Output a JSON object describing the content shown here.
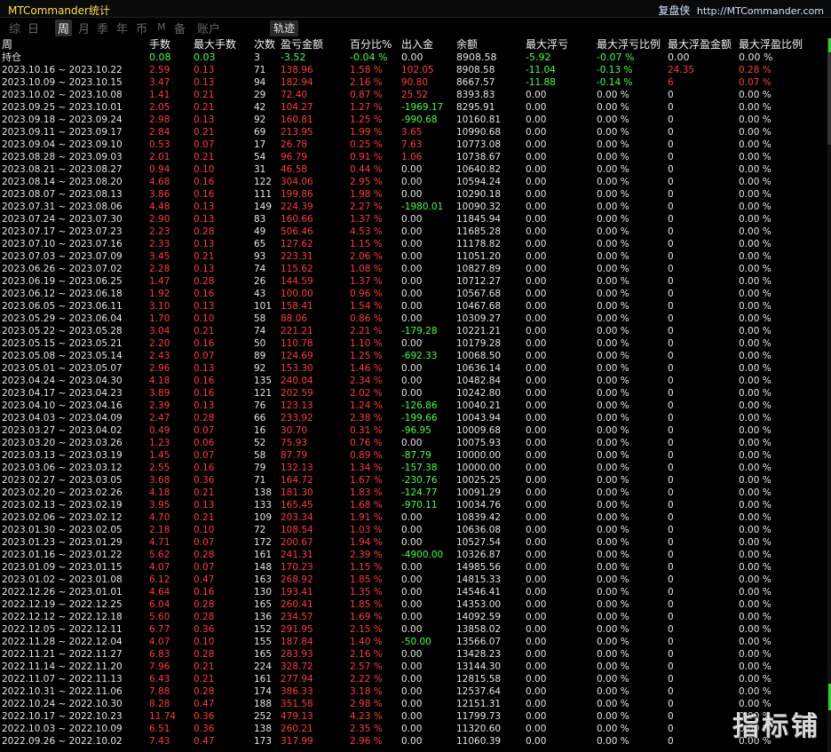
{
  "window": {
    "title": "MTCommander统计"
  },
  "brand": {
    "cn": "复盘侠",
    "url": "http://MTCommander.com"
  },
  "tabs": [
    {
      "label": "综",
      "active": false
    },
    {
      "label": "日",
      "active": false
    },
    {
      "label": "周",
      "active": true
    },
    {
      "label": "月",
      "active": false
    },
    {
      "label": "季",
      "active": false
    },
    {
      "label": "年",
      "active": false
    },
    {
      "label": "币",
      "active": false
    },
    {
      "label": "M",
      "active": false
    },
    {
      "label": "备",
      "active": false
    },
    {
      "label": "账户",
      "active": false
    }
  ],
  "track_button": "轨迹",
  "table": {
    "columns": [
      "周",
      "手数",
      "最大手数",
      "次数",
      "盈亏金额",
      "百分比%",
      "出入金",
      "余额",
      "最大浮亏",
      "最大浮亏比例",
      "最大浮盈金额",
      "最大浮盈比例"
    ],
    "holding": {
      "cells": [
        "持仓",
        "0.08",
        "0.03",
        "3",
        "-3.52",
        "-0.04 %",
        "0.00",
        "8908.58",
        "-5.92",
        "-0.07 %",
        "0.00",
        "0.00 %"
      ],
      "colors": [
        "w",
        "g",
        "g",
        "w",
        "g",
        "g",
        "w",
        "w",
        "g",
        "g",
        "w",
        "w"
      ]
    },
    "rows": [
      [
        "2023.10.16 ~ 2023.10.22",
        "2.59",
        "0.13",
        "71",
        "138.96",
        "1.58 %",
        "102.05",
        "8908.58",
        "-11.04",
        "-0.13 %",
        "24.35",
        "0.28 %"
      ],
      [
        "2023.10.09 ~ 2023.10.15",
        "3.47",
        "0.13",
        "94",
        "182.94",
        "2.16 %",
        "90.80",
        "8667.57",
        "-11.88",
        "-0.14 %",
        "6",
        "0.07 %"
      ],
      [
        "2023.10.02 ~ 2023.10.08",
        "1.41",
        "0.21",
        "29",
        "72.40",
        "0.87 %",
        "25.52",
        "8393.83",
        "0.00",
        "0.00 %",
        "0",
        "0.00 %"
      ],
      [
        "2023.09.25 ~ 2023.10.01",
        "2.05",
        "0.21",
        "42",
        "104.27",
        "1.27 %",
        "-1969.17",
        "8295.91",
        "0.00",
        "0.00 %",
        "0",
        "0.00 %"
      ],
      [
        "2023.09.18 ~ 2023.09.24",
        "2.98",
        "0.13",
        "92",
        "160.81",
        "1.25 %",
        "-990.68",
        "10160.81",
        "0.00",
        "0.00 %",
        "0",
        "0.00 %"
      ],
      [
        "2023.09.11 ~ 2023.09.17",
        "2.84",
        "0.21",
        "69",
        "213.95",
        "1.99 %",
        "3.65",
        "10990.68",
        "0.00",
        "0.00 %",
        "0",
        "0.00 %"
      ],
      [
        "2023.09.04 ~ 2023.09.10",
        "0.53",
        "0.07",
        "17",
        "26.78",
        "0.25 %",
        "7.63",
        "10773.08",
        "0.00",
        "0.00 %",
        "0",
        "0.00 %"
      ],
      [
        "2023.08.28 ~ 2023.09.03",
        "2.01",
        "0.21",
        "54",
        "96.79",
        "0.91 %",
        "1.06",
        "10738.67",
        "0.00",
        "0.00 %",
        "0",
        "0.00 %"
      ],
      [
        "2023.08.21 ~ 2023.08.27",
        "0.94",
        "0.10",
        "31",
        "46.58",
        "0.44 %",
        "0.00",
        "10640.82",
        "0.00",
        "0.00 %",
        "0",
        "0.00 %"
      ],
      [
        "2023.08.14 ~ 2023.08.20",
        "4.68",
        "0.16",
        "122",
        "304.06",
        "2.95 %",
        "0.00",
        "10594.24",
        "0.00",
        "0.00 %",
        "0",
        "0.00 %"
      ],
      [
        "2023.08.07 ~ 2023.08.13",
        "3.86",
        "0.16",
        "111",
        "199.86",
        "1.98 %",
        "0.00",
        "10290.18",
        "0.00",
        "0.00 %",
        "0",
        "0.00 %"
      ],
      [
        "2023.07.31 ~ 2023.08.06",
        "4.48",
        "0.13",
        "149",
        "224.39",
        "2.27 %",
        "-1980.01",
        "10090.32",
        "0.00",
        "0.00 %",
        "0",
        "0.00 %"
      ],
      [
        "2023.07.24 ~ 2023.07.30",
        "2.90",
        "0.13",
        "83",
        "160.66",
        "1.37 %",
        "0.00",
        "11845.94",
        "0.00",
        "0.00 %",
        "0",
        "0.00 %"
      ],
      [
        "2023.07.17 ~ 2023.07.23",
        "2.23",
        "0.28",
        "49",
        "506.46",
        "4.53 %",
        "0.00",
        "11685.28",
        "0.00",
        "0.00 %",
        "0",
        "0.00 %"
      ],
      [
        "2023.07.10 ~ 2023.07.16",
        "2.33",
        "0.13",
        "65",
        "127.62",
        "1.15 %",
        "0.00",
        "11178.82",
        "0.00",
        "0.00 %",
        "0",
        "0.00 %"
      ],
      [
        "2023.07.03 ~ 2023.07.09",
        "3.45",
        "0.21",
        "93",
        "223.31",
        "2.06 %",
        "0.00",
        "11051.20",
        "0.00",
        "0.00 %",
        "0",
        "0.00 %"
      ],
      [
        "2023.06.26 ~ 2023.07.02",
        "2.28",
        "0.13",
        "74",
        "115.62",
        "1.08 %",
        "0.00",
        "10827.89",
        "0.00",
        "0.00 %",
        "0",
        "0.00 %"
      ],
      [
        "2023.06.19 ~ 2023.06.25",
        "1.47",
        "0.28",
        "26",
        "144.59",
        "1.37 %",
        "0.00",
        "10712.27",
        "0.00",
        "0.00 %",
        "0",
        "0.00 %"
      ],
      [
        "2023.06.12 ~ 2023.06.18",
        "1.92",
        "0.16",
        "43",
        "100.00",
        "0.96 %",
        "0.00",
        "10567.68",
        "0.00",
        "0.00 %",
        "0",
        "0.00 %"
      ],
      [
        "2023.06.05 ~ 2023.06.11",
        "3.10",
        "0.13",
        "101",
        "158.41",
        "1.54 %",
        "0.00",
        "10467.68",
        "0.00",
        "0.00 %",
        "0",
        "0.00 %"
      ],
      [
        "2023.05.29 ~ 2023.06.04",
        "1.70",
        "0.10",
        "58",
        "88.06",
        "0.86 %",
        "0.00",
        "10309.27",
        "0.00",
        "0.00 %",
        "0",
        "0.00 %"
      ],
      [
        "2023.05.22 ~ 2023.05.28",
        "3.04",
        "0.21",
        "74",
        "221.21",
        "2.21 %",
        "-179.28",
        "10221.21",
        "0.00",
        "0.00 %",
        "0",
        "0.00 %"
      ],
      [
        "2023.05.15 ~ 2023.05.21",
        "2.20",
        "0.16",
        "50",
        "110.78",
        "1.10 %",
        "0.00",
        "10179.28",
        "0.00",
        "0.00 %",
        "0",
        "0.00 %"
      ],
      [
        "2023.05.08 ~ 2023.05.14",
        "2.43",
        "0.07",
        "89",
        "124.69",
        "1.25 %",
        "-692.33",
        "10068.50",
        "0.00",
        "0.00 %",
        "0",
        "0.00 %"
      ],
      [
        "2023.05.01 ~ 2023.05.07",
        "2.96",
        "0.13",
        "92",
        "153.30",
        "1.46 %",
        "0.00",
        "10636.14",
        "0.00",
        "0.00 %",
        "0",
        "0.00 %"
      ],
      [
        "2023.04.24 ~ 2023.04.30",
        "4.18",
        "0.16",
        "135",
        "240.04",
        "2.34 %",
        "0.00",
        "10482.84",
        "0.00",
        "0.00 %",
        "0",
        "0.00 %"
      ],
      [
        "2023.04.17 ~ 2023.04.23",
        "3.89",
        "0.16",
        "121",
        "202.59",
        "2.02 %",
        "0.00",
        "10242.80",
        "0.00",
        "0.00 %",
        "0",
        "0.00 %"
      ],
      [
        "2023.04.10 ~ 2023.04.16",
        "2.39",
        "0.13",
        "76",
        "123.13",
        "1.24 %",
        "-126.86",
        "10040.21",
        "0.00",
        "0.00 %",
        "0",
        "0.00 %"
      ],
      [
        "2023.04.03 ~ 2023.04.09",
        "2.47",
        "0.28",
        "66",
        "233.92",
        "2.38 %",
        "-199.66",
        "10043.94",
        "0.00",
        "0.00 %",
        "0",
        "0.00 %"
      ],
      [
        "2023.03.27 ~ 2023.04.02",
        "0.49",
        "0.07",
        "16",
        "30.70",
        "0.31 %",
        "-96.95",
        "10009.68",
        "0.00",
        "0.00 %",
        "0",
        "0.00 %"
      ],
      [
        "2023.03.20 ~ 2023.03.26",
        "1.23",
        "0.06",
        "52",
        "75.93",
        "0.76 %",
        "0.00",
        "10075.93",
        "0.00",
        "0.00 %",
        "0",
        "0.00 %"
      ],
      [
        "2023.03.13 ~ 2023.03.19",
        "1.45",
        "0.07",
        "58",
        "87.79",
        "0.89 %",
        "-87.79",
        "10000.00",
        "0.00",
        "0.00 %",
        "0",
        "0.00 %"
      ],
      [
        "2023.03.06 ~ 2023.03.12",
        "2.55",
        "0.16",
        "79",
        "132.13",
        "1.34 %",
        "-157.38",
        "10000.00",
        "0.00",
        "0.00 %",
        "0",
        "0.00 %"
      ],
      [
        "2023.02.27 ~ 2023.03.05",
        "3.68",
        "0.36",
        "71",
        "164.72",
        "1.67 %",
        "-230.76",
        "10025.25",
        "0.00",
        "0.00 %",
        "0",
        "0.00 %"
      ],
      [
        "2023.02.20 ~ 2023.02.26",
        "4.18",
        "0.21",
        "138",
        "181.30",
        "1.83 %",
        "-124.77",
        "10091.29",
        "0.00",
        "0.00 %",
        "0",
        "0.00 %"
      ],
      [
        "2023.02.13 ~ 2023.02.19",
        "3.95",
        "0.13",
        "133",
        "165.45",
        "1.68 %",
        "-970.11",
        "10034.76",
        "0.00",
        "0.00 %",
        "0",
        "0.00 %"
      ],
      [
        "2023.02.06 ~ 2023.02.12",
        "4.70",
        "0.21",
        "109",
        "203.34",
        "1.91 %",
        "0.00",
        "10839.42",
        "0.00",
        "0.00 %",
        "0",
        "0.00 %"
      ],
      [
        "2023.01.30 ~ 2023.02.05",
        "2.18",
        "0.10",
        "72",
        "108.54",
        "1.03 %",
        "0.00",
        "10636.08",
        "0.00",
        "0.00 %",
        "0",
        "0.00 %"
      ],
      [
        "2023.01.23 ~ 2023.01.29",
        "4.71",
        "0.07",
        "172",
        "200.67",
        "1.94 %",
        "0.00",
        "10527.54",
        "0.00",
        "0.00 %",
        "0",
        "0.00 %"
      ],
      [
        "2023.01.16 ~ 2023.01.22",
        "5.62",
        "0.28",
        "161",
        "241.31",
        "2.39 %",
        "-4900.00",
        "10326.87",
        "0.00",
        "0.00 %",
        "0",
        "0.00 %"
      ],
      [
        "2023.01.09 ~ 2023.01.15",
        "4.07",
        "0.07",
        "148",
        "170.23",
        "1.15 %",
        "0.00",
        "14985.56",
        "0.00",
        "0.00 %",
        "0",
        "0.00 %"
      ],
      [
        "2023.01.02 ~ 2023.01.08",
        "6.12",
        "0.47",
        "163",
        "268.92",
        "1.85 %",
        "0.00",
        "14815.33",
        "0.00",
        "0.00 %",
        "0",
        "0.00 %"
      ],
      [
        "2022.12.26 ~ 2023.01.01",
        "4.64",
        "0.16",
        "130",
        "193.41",
        "1.35 %",
        "0.00",
        "14546.41",
        "0.00",
        "0.00 %",
        "0",
        "0.00 %"
      ],
      [
        "2022.12.19 ~ 2022.12.25",
        "6.04",
        "0.28",
        "165",
        "260.41",
        "1.85 %",
        "0.00",
        "14353.00",
        "0.00",
        "0.00 %",
        "0",
        "0.00 %"
      ],
      [
        "2022.12.12 ~ 2022.12.18",
        "5.60",
        "0.28",
        "136",
        "234.57",
        "1.69 %",
        "0.00",
        "14092.59",
        "0.00",
        "0.00 %",
        "0",
        "0.00 %"
      ],
      [
        "2022.12.05 ~ 2022.12.11",
        "6.77",
        "0.36",
        "152",
        "291.95",
        "2.15 %",
        "0.00",
        "13858.02",
        "0.00",
        "0.00 %",
        "0",
        "0.00 %"
      ],
      [
        "2022.11.28 ~ 2022.12.04",
        "4.07",
        "0.10",
        "155",
        "187.84",
        "1.40 %",
        "-50.00",
        "13566.07",
        "0.00",
        "0.00 %",
        "0",
        "0.00 %"
      ],
      [
        "2022.11.21 ~ 2022.11.27",
        "6.83",
        "0.28",
        "165",
        "283.93",
        "2.16 %",
        "0.00",
        "13428.23",
        "0.00",
        "0.00 %",
        "0",
        "0.00 %"
      ],
      [
        "2022.11.14 ~ 2022.11.20",
        "7.96",
        "0.21",
        "224",
        "328.72",
        "2.57 %",
        "0.00",
        "13144.30",
        "0.00",
        "0.00 %",
        "0",
        "0.00 %"
      ],
      [
        "2022.11.07 ~ 2022.11.13",
        "6.43",
        "0.21",
        "161",
        "277.94",
        "2.22 %",
        "0.00",
        "12815.58",
        "0.00",
        "0.00 %",
        "0",
        "0.00 %"
      ],
      [
        "2022.10.31 ~ 2022.11.06",
        "7.88",
        "0.28",
        "174",
        "386.33",
        "3.18 %",
        "0.00",
        "12537.64",
        "0.00",
        "0.00 %",
        "0",
        "0.00 %"
      ],
      [
        "2022.10.24 ~ 2022.10.30",
        "8.28",
        "0.47",
        "188",
        "351.58",
        "2.98 %",
        "0.00",
        "12151.31",
        "0.00",
        "0.00 %",
        "0",
        "0.00 %"
      ],
      [
        "2022.10.17 ~ 2022.10.23",
        "11.74",
        "0.36",
        "252",
        "479.13",
        "4.23 %",
        "0.00",
        "11799.73",
        "0.00",
        "0.00 %",
        "0",
        "0.00 %"
      ],
      [
        "2022.10.03 ~ 2022.10.09",
        "6.51",
        "0.36",
        "138",
        "260.21",
        "2.35 %",
        "0.00",
        "11320.60",
        "0.00",
        "0.00 %",
        "0",
        "0.00 %"
      ],
      [
        "2022.09.26 ~ 2022.10.02",
        "7.43",
        "0.47",
        "173",
        "317.99",
        "2.96 %",
        "0.00",
        "11060.39",
        "0.00",
        "0.00 %",
        "0",
        "0.00 %"
      ]
    ]
  },
  "watermark": "指标铺",
  "colors": {
    "loss_green": "#46ff46",
    "profit_red": "#ff3b3b",
    "title_yellow": "#ffe14d",
    "header_white": "#f2f2f2"
  }
}
